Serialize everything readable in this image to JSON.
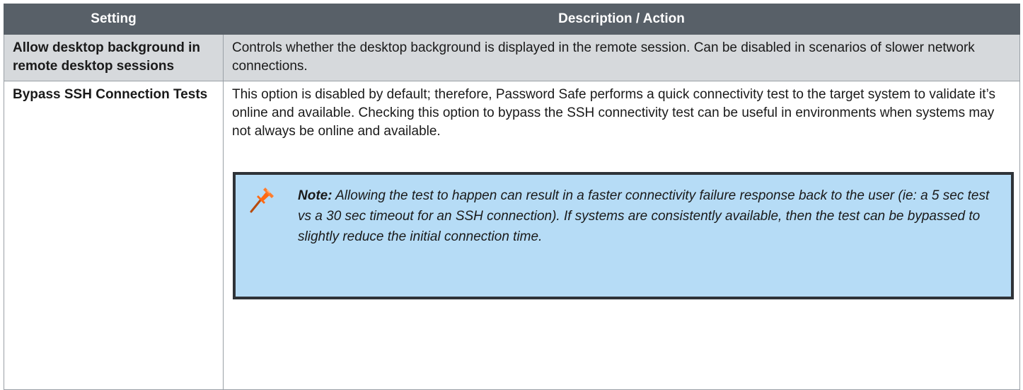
{
  "table": {
    "headers": {
      "setting": "Setting",
      "description": "Description / Action"
    },
    "rows": [
      {
        "setting": "Allow desktop background in remote desktop sessions",
        "description": "Controls whether the desktop background is displayed in the remote session. Can be disabled in scenarios of slower network connections."
      },
      {
        "setting": "Bypass SSH Connection Tests",
        "description": "This option is disabled by default; therefore, Password Safe performs a quick connectivity test to the target system to validate it’s online and available. Checking this option to bypass the SSH connectivity test can be useful in environments when systems may not always be online and available.",
        "note": {
          "icon": "pushpin-icon",
          "label": "Note:",
          "text": " Allowing the test to happen can result in a faster connectivity failure response back to the user (ie: a 5 sec test vs a 30 sec timeout for an SSH connection). If systems are consistently available, then the test can be bypassed to slightly reduce the initial connection time."
        }
      }
    ]
  },
  "colors": {
    "header_bg": "#586068",
    "shaded_row_bg": "#d6d9dc",
    "note_bg": "#b6dcf6",
    "note_border": "#2f3338",
    "pin_accent": "#ff6a13"
  }
}
